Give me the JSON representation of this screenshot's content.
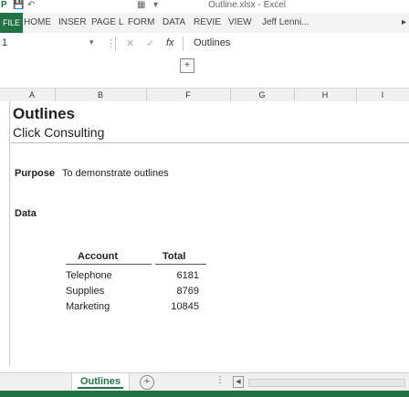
{
  "colors": {
    "accent": "#217346"
  },
  "quick_access": {
    "app_letter": "P",
    "save_icon": "save-icon",
    "undo_icon": "undo-icon",
    "filename": "Outline.xlsx - Excel"
  },
  "ribbon": {
    "file": "FILE",
    "tabs": [
      "HOME",
      "INSER",
      "PAGE L",
      "FORM",
      "DATA",
      "REVIE",
      "VIEW"
    ],
    "user": "Jeff Lenni..."
  },
  "formula_bar": {
    "name_box": "1",
    "fx": "fx",
    "content": "Outlines"
  },
  "expand_button": "+",
  "columns": [
    "A",
    "B",
    "F",
    "G",
    "H",
    "I"
  ],
  "sheet": {
    "title": "Outlines",
    "subtitle": "Click Consulting",
    "purpose_label": "Purpose",
    "purpose_value": "To demonstrate outlines",
    "data_label": "Data",
    "table": {
      "headers": [
        "Account",
        "Total"
      ],
      "rows": [
        {
          "account": "Telephone",
          "total": "6181"
        },
        {
          "account": "Supplies",
          "total": "8769"
        },
        {
          "account": "Marketing",
          "total": "10845"
        }
      ]
    }
  },
  "sheet_tabs": {
    "active": "Outlines",
    "add_label": "+",
    "dots": "⋮",
    "scroll_left": "◀"
  }
}
